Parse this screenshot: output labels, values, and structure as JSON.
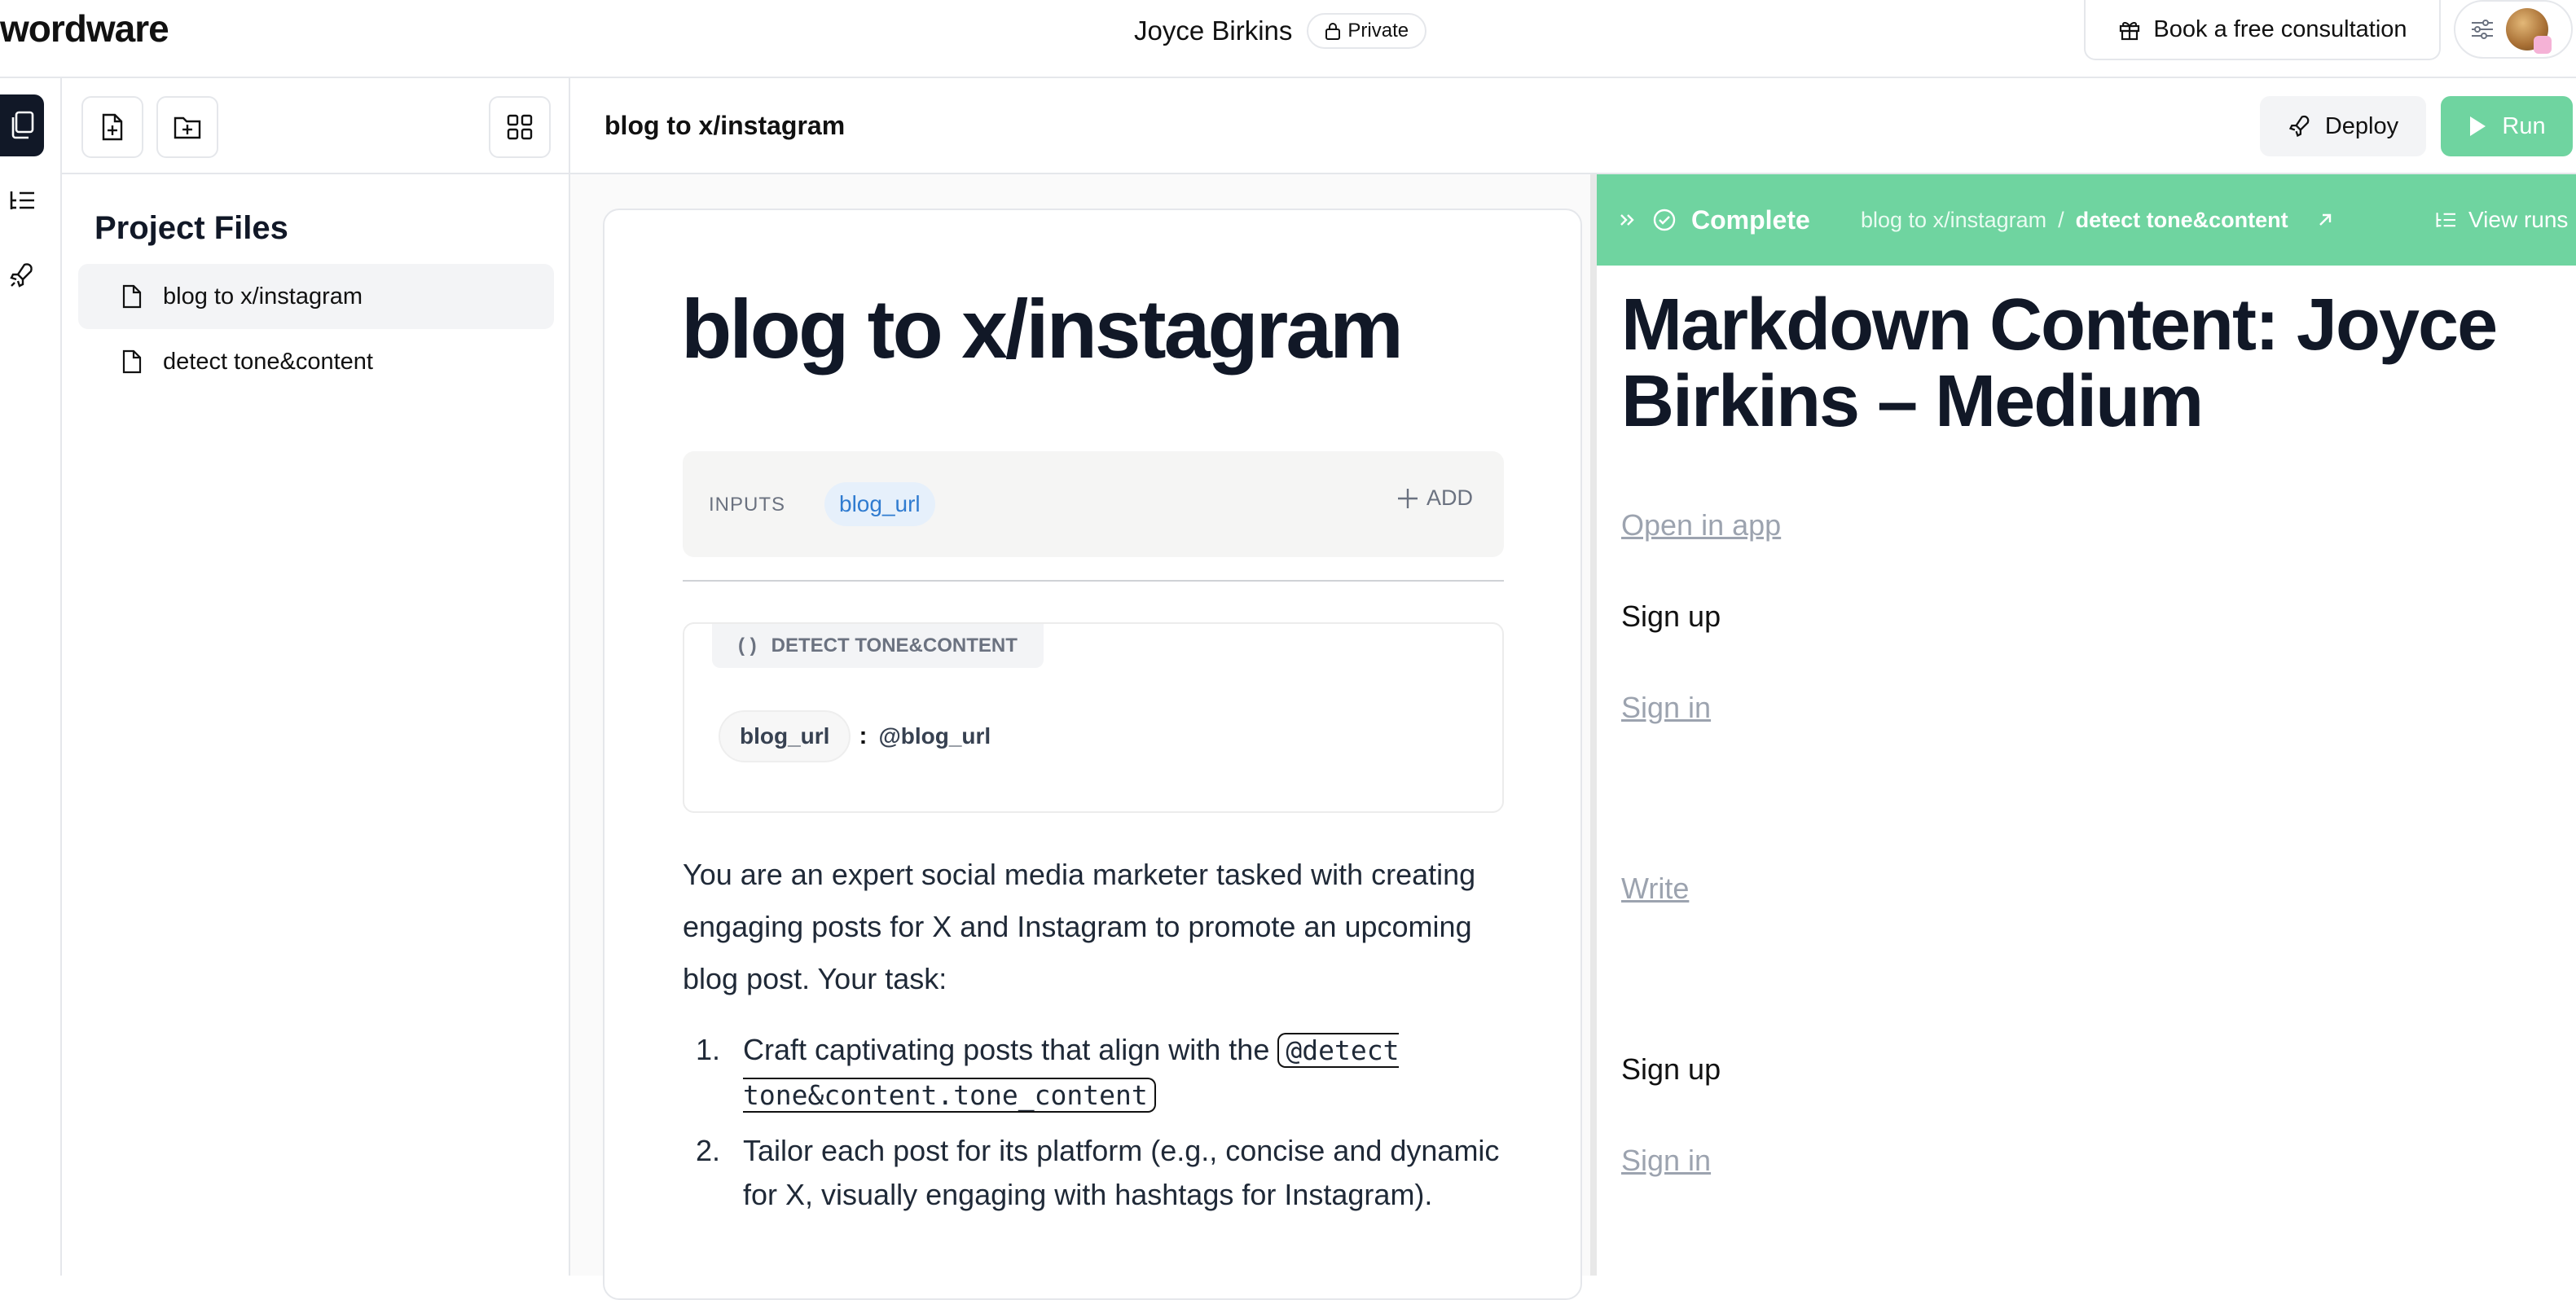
{
  "app": {
    "logo": "wordware"
  },
  "header": {
    "owner_name": "Joyce Birkins",
    "visibility": "Private",
    "consult_label": "Book a free consultation"
  },
  "sidebar": {
    "title": "Project Files",
    "files": [
      {
        "name": "blog to x/instagram"
      },
      {
        "name": "detect tone&content"
      }
    ]
  },
  "editor": {
    "doc_title": "blog to x/instagram",
    "deploy_label": "Deploy",
    "run_label": "Run",
    "heading": "blog to x/instagram",
    "inputs_label": "INPUTS",
    "input_chip": "blog_url",
    "add_label": "ADD",
    "call_tag_glyph": "( )",
    "call_tag": "DETECT TONE&CONTENT",
    "param_name": "blog_url",
    "param_colon": ":",
    "param_value": "@blog_url",
    "prompt": "You are an expert social media marketer tasked with creating engaging posts for X and Instagram to promote an upcoming blog post. Your task:",
    "list": [
      {
        "num": "1.",
        "text": "Craft captivating posts that align with the ",
        "ref": "@detect tone&content.tone_content"
      },
      {
        "num": "2.",
        "text": "Tailor each post for its platform (e.g., concise and dynamic for X, visually engaging with hashtags for Instagram)."
      }
    ]
  },
  "output": {
    "status": "Complete",
    "crumb_parent": "blog to x/instagram",
    "crumb_sep": "/",
    "crumb_current": "detect tone&content",
    "view_runs": "View runs",
    "heading": "Markdown Content: Joyce Birkins – Medium",
    "items": [
      {
        "text": "Open in app",
        "kind": "link"
      },
      {
        "text": "Sign up",
        "kind": "text"
      },
      {
        "text": "Sign in",
        "kind": "link"
      },
      {
        "text": "Write",
        "kind": "link"
      },
      {
        "text": "Sign up",
        "kind": "text"
      },
      {
        "text": "Sign in",
        "kind": "link"
      }
    ]
  },
  "colors": {
    "accent_green": "#6fd4a0",
    "chip_blue": "#2f7bd0",
    "dark": "#111827"
  }
}
